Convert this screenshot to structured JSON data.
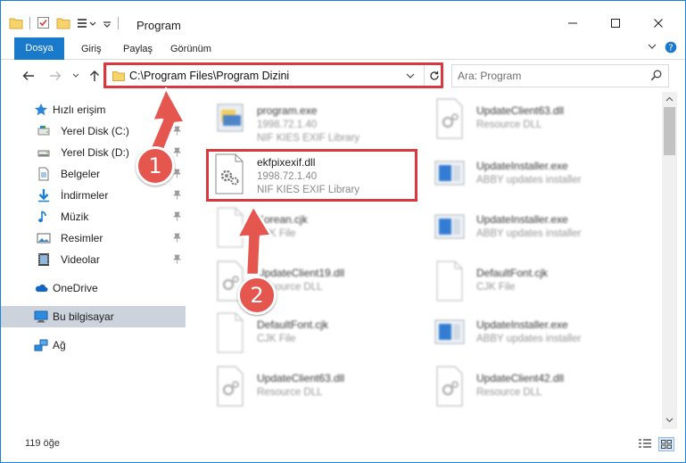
{
  "window": {
    "title": "Program",
    "colors": {
      "accent": "#1979ca",
      "highlight": "#d9383f",
      "marker": "#e5564f",
      "selected": "#ccd3dc"
    }
  },
  "ribbon": {
    "tabs": [
      "Dosya",
      "Giriş",
      "Paylaş",
      "Görünüm"
    ]
  },
  "address": {
    "path": "C:\\Program Files\\Program Dizini"
  },
  "search": {
    "placeholder": "Ara: Program"
  },
  "sidebar": {
    "quick_access": "Hızlı erişim",
    "items": [
      {
        "label": "Yerel Disk (C:)",
        "icon": "drive-icon"
      },
      {
        "label": "Yerel Disk (D:)",
        "icon": "drive-icon"
      },
      {
        "label": "Belgeler",
        "icon": "documents-icon"
      },
      {
        "label": "İndirmeler",
        "icon": "downloads-icon"
      },
      {
        "label": "Müzik",
        "icon": "music-icon"
      },
      {
        "label": "Resimler",
        "icon": "pictures-icon"
      },
      {
        "label": "Videolar",
        "icon": "videos-icon"
      }
    ],
    "onedrive": "OneDrive",
    "this_pc": "Bu bilgisayar",
    "network": "Ağ"
  },
  "files": [
    {
      "name": "program.exe",
      "line2": "1998.72.1.40",
      "line3": "NIF KIES EXIF Library",
      "icon": "exe-icon"
    },
    {
      "name": "UpdateClient63.dll",
      "line2": "Resource DLL",
      "line3": "",
      "icon": "dll-icon"
    },
    {
      "name": "ekfpixexif.dll",
      "line2": "1998.72.1.40",
      "line3": "NIF KIES EXIF Library",
      "icon": "dll-gear-icon"
    },
    {
      "name": "UpdateInstaller.exe",
      "line2": "ABBY updates installer",
      "line3": "",
      "icon": "installer-icon"
    },
    {
      "name": "Korean.cjk",
      "line2": "CJK File",
      "line3": "",
      "icon": "file-icon"
    },
    {
      "name": "UpdateInstaller.exe",
      "line2": "ABBY updates installer",
      "line3": "",
      "icon": "installer-icon"
    },
    {
      "name": "UpdateClient19.dll",
      "line2": "Resource DLL",
      "line3": "",
      "icon": "dll-icon"
    },
    {
      "name": "DefaultFont.cjk",
      "line2": "CJK File",
      "line3": "",
      "icon": "file-icon"
    },
    {
      "name": "DefaultFont.cjk",
      "line2": "CJK File",
      "line3": "",
      "icon": "file-icon"
    },
    {
      "name": "UpdateInstaller.exe",
      "line2": "ABBY updates installer",
      "line3": "",
      "icon": "installer-icon"
    },
    {
      "name": "UpdateClient63.dll",
      "line2": "Resource DLL",
      "line3": "",
      "icon": "dll-icon"
    },
    {
      "name": "UpdateClient42.dll",
      "line2": "Resource DLL",
      "line3": "",
      "icon": "dll-icon"
    }
  ],
  "status": {
    "count": "119 öğe"
  },
  "annotations": {
    "marker1": "1",
    "marker2": "2"
  }
}
